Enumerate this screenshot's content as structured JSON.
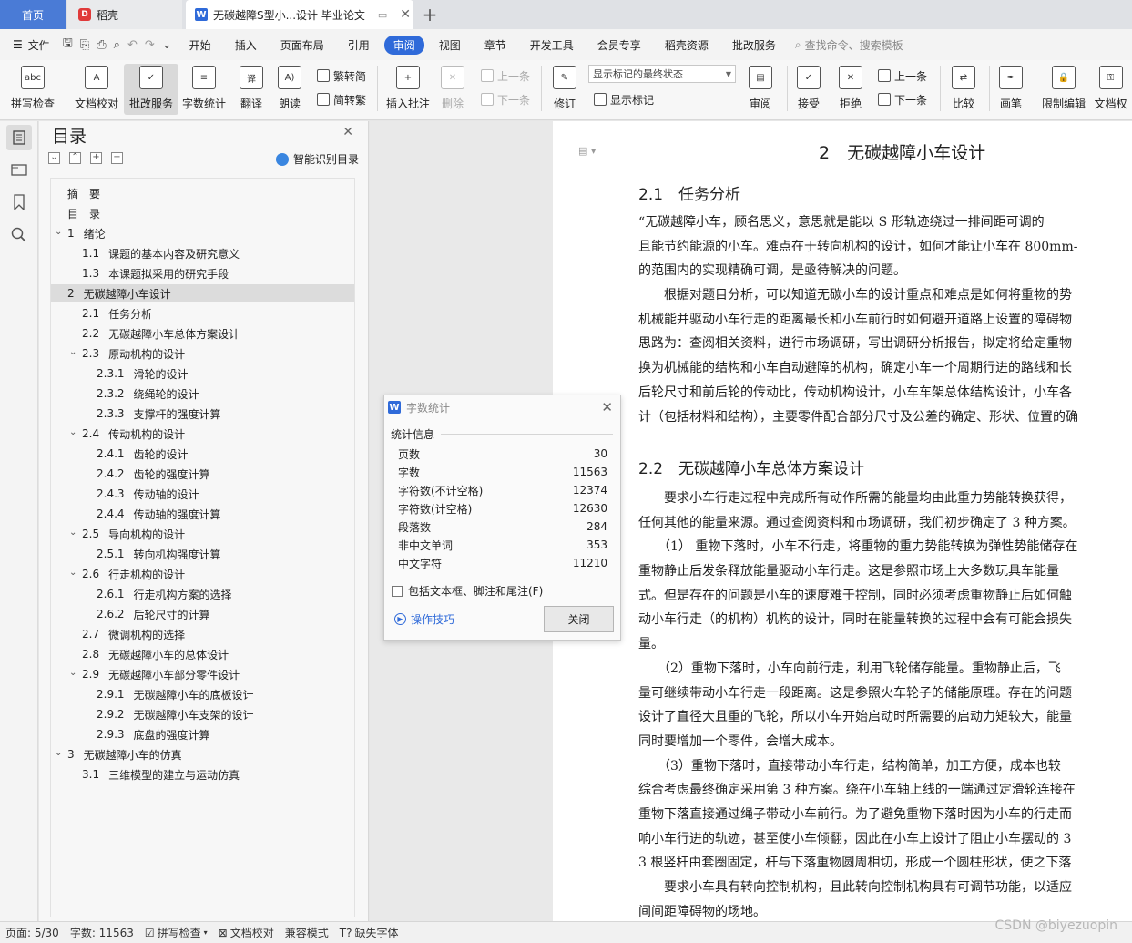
{
  "tabs": {
    "home": "首页",
    "daoke": "稻壳",
    "doc": "无碳越障S型小...设计 毕业论文"
  },
  "menu": {
    "file": "文件",
    "items": [
      "开始",
      "插入",
      "页面布局",
      "引用",
      "审阅",
      "视图",
      "章节",
      "开发工具",
      "会员专享",
      "稻壳资源",
      "批改服务"
    ],
    "search": "查找命令、搜索模板"
  },
  "ribbon": {
    "spell": "拼写检查",
    "proofread": "文档校对",
    "correction": "批改服务",
    "wordcount": "字数统计",
    "translate": "翻译",
    "read": "朗读",
    "trad": "繁转简",
    "simp": "简转繁",
    "insert_comment": "插入批注",
    "delete": "删除",
    "prev": "上一条",
    "next": "下一条",
    "revise": "修订",
    "markup_state": "显示标记的最终状态",
    "show_markup": "显示标记",
    "review": "审阅",
    "accept": "接受",
    "reject": "拒绝",
    "prev2": "上一条",
    "next2": "下一条",
    "compare": "比较",
    "pen": "画笔",
    "restrict": "限制编辑",
    "doc_perm": "文档权"
  },
  "toc": {
    "title": "目录",
    "smart": "智能识别目录",
    "items": [
      {
        "num": "",
        "text": "摘　要"
      },
      {
        "num": "",
        "text": "目　录"
      },
      {
        "num": "1",
        "text": "绪论"
      },
      {
        "num": "1.1",
        "text": "课题的基本内容及研究意义"
      },
      {
        "num": "1.3",
        "text": "本课题拟采用的研究手段"
      },
      {
        "num": "2",
        "text": "无碳越障小车设计"
      },
      {
        "num": "2.1",
        "text": "任务分析"
      },
      {
        "num": "2.2",
        "text": "无碳越障小车总体方案设计"
      },
      {
        "num": "2.3",
        "text": "原动机构的设计"
      },
      {
        "num": "2.3.1",
        "text": "滑轮的设计"
      },
      {
        "num": "2.3.2",
        "text": "绕绳轮的设计"
      },
      {
        "num": "2.3.3",
        "text": "支撑杆的强度计算"
      },
      {
        "num": "2.4",
        "text": "传动机构的设计"
      },
      {
        "num": "2.4.1",
        "text": "齿轮的设计"
      },
      {
        "num": "2.4.2",
        "text": "齿轮的强度计算"
      },
      {
        "num": "2.4.3",
        "text": "传动轴的设计"
      },
      {
        "num": "2.4.4",
        "text": "传动轴的强度计算"
      },
      {
        "num": "2.5",
        "text": "导向机构的设计"
      },
      {
        "num": "2.5.1",
        "text": "转向机构强度计算"
      },
      {
        "num": "2.6",
        "text": "行走机构的设计"
      },
      {
        "num": "2.6.1",
        "text": "行走机构方案的选择"
      },
      {
        "num": "2.6.2",
        "text": "后轮尺寸的计算"
      },
      {
        "num": "2.7",
        "text": "微调机构的选择"
      },
      {
        "num": "2.8",
        "text": "无碳越障小车的总体设计"
      },
      {
        "num": "2.9",
        "text": "无碳越障小车部分零件设计"
      },
      {
        "num": "2.9.1",
        "text": "无碳越障小车的底板设计"
      },
      {
        "num": "2.9.2",
        "text": "无碳越障小车支架的设计"
      },
      {
        "num": "2.9.3",
        "text": "底盘的强度计算"
      },
      {
        "num": "3",
        "text": "无碳越障小车的仿真"
      },
      {
        "num": "3.1",
        "text": "三维模型的建立与运动仿真"
      }
    ]
  },
  "document": {
    "h1": "2　无碳越障小车设计",
    "h2_1": "2.1　任务分析",
    "h2_2": "2.2　无碳越障小车总体方案设计",
    "para1": [
      "“无碳越障小车，顾名思义，意思就是能以 S 形轨迹绕过一排间距可调的",
      "且能节约能源的小车。难点在于转向机构的设计，如何才能让小车在 800mm-",
      "的范围内的实现精确可调，是亟待解决的问题。",
      "　　根据对题目分析，可以知道无碳小车的设计重点和难点是如何将重物的势",
      "机械能并驱动小车行走的距离最长和小车前行时如何避开道路上设置的障碍物",
      "思路为：查阅相关资料，进行市场调研，写出调研分析报告，拟定将给定重物",
      "换为机械能的结构和小车自动避障的机构，确定小车一个周期行进的路线和长",
      "后轮尺寸和前后轮的传动比，传动机构设计，小车车架总体结构设计，小车各",
      "计（包括材料和结构），主要零件配合部分尺寸及公差的确定、形状、位置的确"
    ],
    "para2": [
      "　　要求小车行走过程中完成所有动作所需的能量均由此重力势能转换获得，",
      "任何其他的能量来源。通过查阅资料和市场调研，我们初步确定了 3 种方案。",
      "　　（1） 重物下落时，小车不行走，将重物的重力势能转换为弹性势能储存在",
      "重物静止后发条释放能量驱动小车行走。这是参照市场上大多数玩具车能量",
      "式。但是存在的问题是小车的速度难于控制，同时必须考虑重物静止后如何触",
      "动小车行走（的机构）机构的设计，同时在能量转换的过程中会有可能会损失",
      "量。",
      "　　（2）重物下落时，小车向前行走，利用飞轮储存能量。重物静止后，飞",
      "量可继续带动小车行走一段距离。这是参照火车轮子的储能原理。存在的问题",
      "设计了直径大且重的飞轮，所以小车开始启动时所需要的启动力矩较大，能量",
      "同时要增加一个零件，会增大成本。",
      "　　（3）重物下落时，直接带动小车行走，结构简单，加工方便，成本也较",
      "综合考虑最终确定采用第 3 种方案。绕在小车轴上线的一端通过定滑轮连接在",
      "重物下落直接通过绳子带动小车前行。为了避免重物下落时因为小车的行走而",
      "响小车行进的轨迹，甚至使小车倾翻，因此在小车上设计了阻止小车摆动的 3",
      "3 根竖杆由套圈固定，杆与下落重物圆周相切，形成一个圆柱形状，使之下落",
      "　　要求小车具有转向控制机构，且此转向控制机构具有可调节功能，以适应",
      " 间间距障碍物的场地。"
    ]
  },
  "dialog": {
    "title": "字数统计",
    "section": "统计信息",
    "stats": [
      {
        "label": "页数",
        "value": "30"
      },
      {
        "label": "字数",
        "value": "11563"
      },
      {
        "label": "字符数(不计空格)",
        "value": "12374"
      },
      {
        "label": "字符数(计空格)",
        "value": "12630"
      },
      {
        "label": "段落数",
        "value": "284"
      },
      {
        "label": "非中文单词",
        "value": "353"
      },
      {
        "label": "中文字符",
        "value": "11210"
      }
    ],
    "checkbox": "包括文本框、脚注和尾注(F)",
    "tips": "操作技巧",
    "close": "关闭"
  },
  "status": {
    "page": "页面: 5/30",
    "words": "字数: 11563",
    "spell": "拼写检查",
    "proof": "文档校对",
    "compat": "兼容模式",
    "missing_font": "缺失字体"
  },
  "watermark": "CSDN @biyezuopin"
}
